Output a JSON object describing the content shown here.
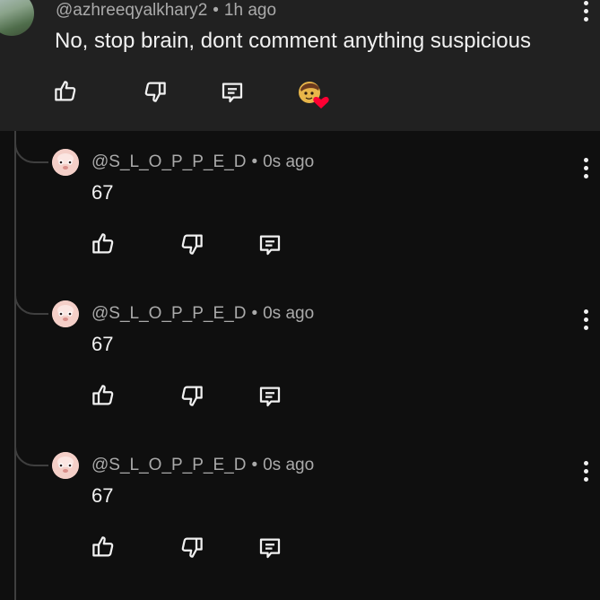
{
  "parent_comment": {
    "author": "@azhreeqyalkhary2",
    "separator": "•",
    "time": "1h ago",
    "text": "No, stop brain, dont comment anything suspicious",
    "actions": [
      "like",
      "dislike",
      "reply",
      "creator-heart"
    ]
  },
  "replies": [
    {
      "author": "@S_L_O_P_P_E_D",
      "separator": "•",
      "time": "0s ago",
      "text": "67"
    },
    {
      "author": "@S_L_O_P_P_E_D",
      "separator": "•",
      "time": "0s ago",
      "text": "67"
    },
    {
      "author": "@S_L_O_P_P_E_D",
      "separator": "•",
      "time": "0s ago",
      "text": "67"
    }
  ],
  "icons": {
    "like": "thumbs-up-icon",
    "dislike": "thumbs-down-icon",
    "reply": "reply-icon",
    "more": "more-vert-icon",
    "heart": "creator-heart-icon"
  },
  "colors": {
    "background": "#0f0f0f",
    "parent_background": "#212121",
    "text_primary": "#f1f1f1",
    "text_secondary": "#aaaaaa",
    "heart": "#ff0033"
  }
}
